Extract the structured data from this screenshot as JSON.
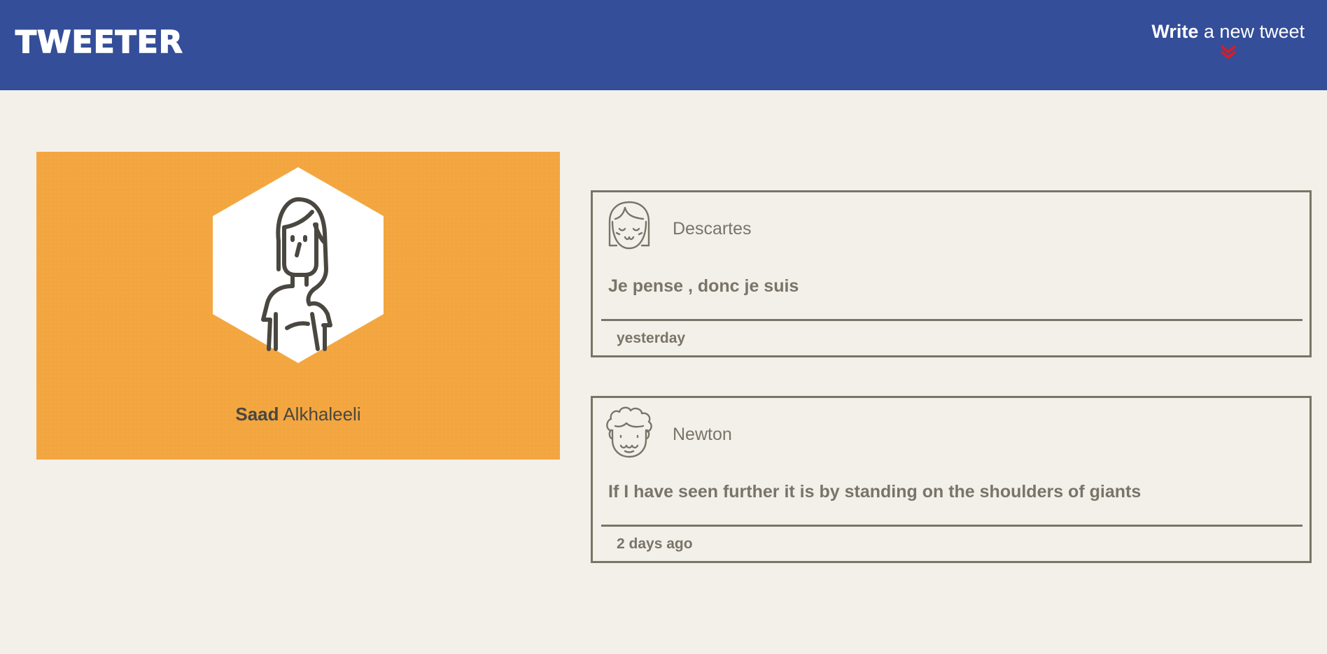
{
  "nav": {
    "brand": "TWEETER",
    "compose_strong": "Write",
    "compose_rest": " a new tweet",
    "accent": "#344e99",
    "chevron_color": "#d21f2b",
    "chevron_icon": "double-chevron-down"
  },
  "profile": {
    "first_name": "Saad",
    "last_name": " Alkhaleeli",
    "card_color": "#f3a63f",
    "avatar_icon": "woman-avatar"
  },
  "tweets": [
    {
      "handle": "Descartes",
      "avatar_icon": "girl-face-avatar",
      "text": "Je pense , donc je suis",
      "time": "yesterday"
    },
    {
      "handle": "Newton",
      "avatar_icon": "curly-hair-face-avatar",
      "text": "If I have seen further it is by standing on the shoulders of giants",
      "time": "2 days ago"
    }
  ]
}
